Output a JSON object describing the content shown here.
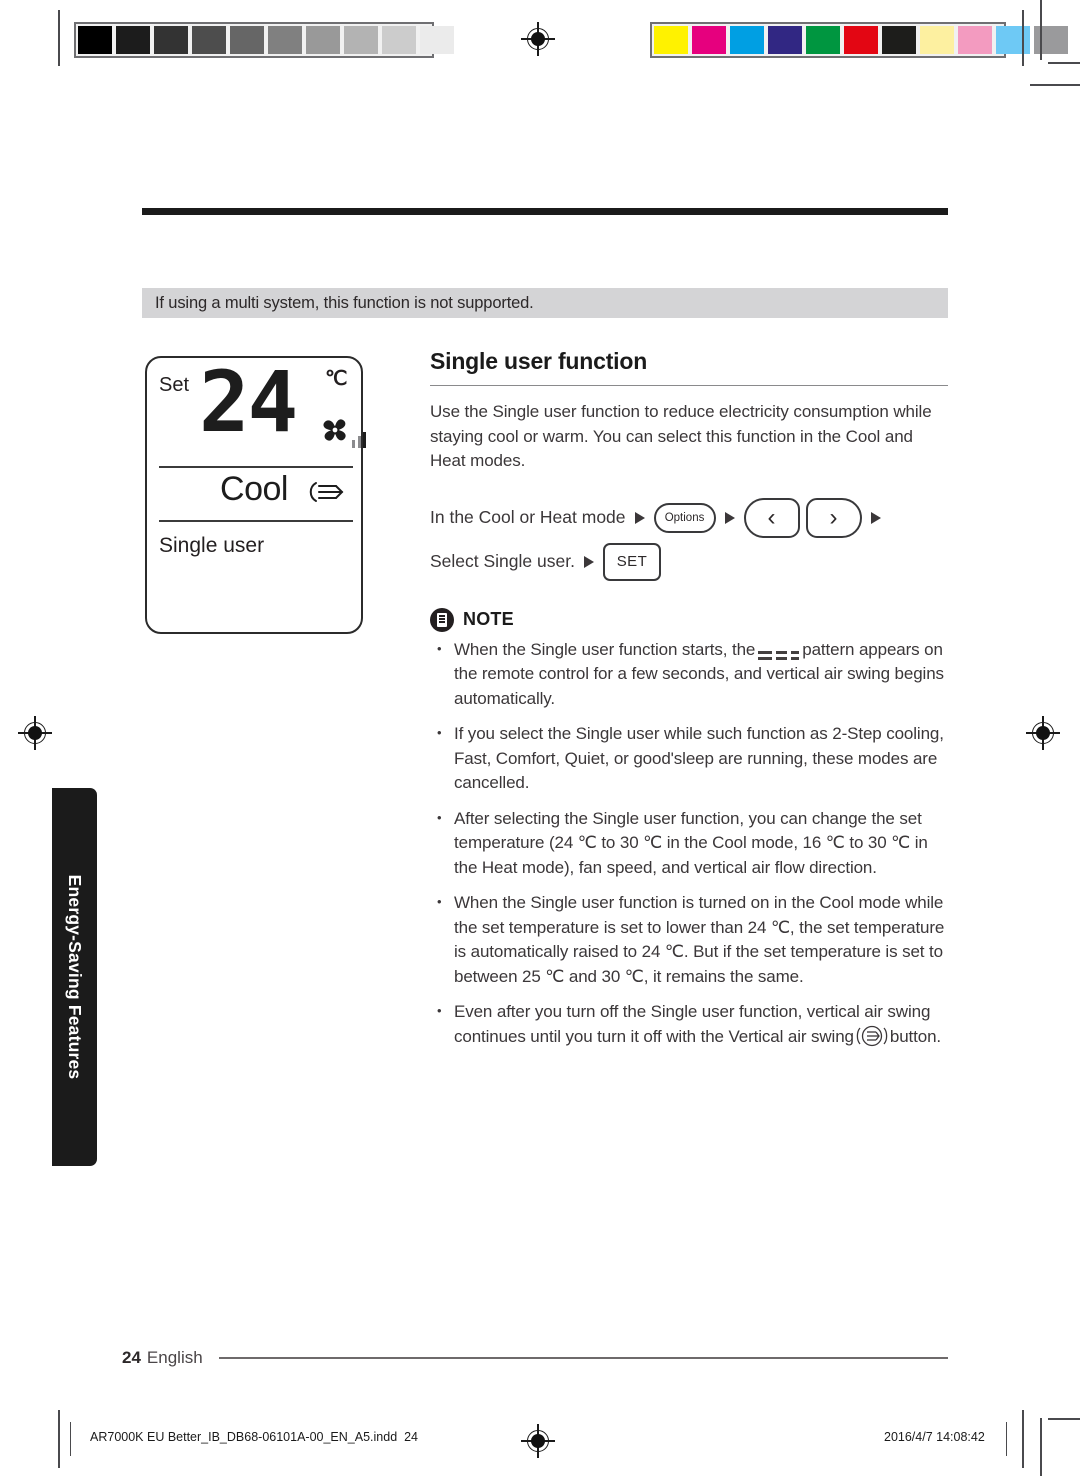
{
  "print_marks": {
    "grayscale_swatches": [
      "#000000",
      "#1c1c1c",
      "#333333",
      "#4d4d4d",
      "#666666",
      "#808080",
      "#999999",
      "#b3b3b3",
      "#cccccc",
      "#ebebeb",
      "#ffffff"
    ],
    "color_swatches": [
      "#fff200",
      "#e6007e",
      "#009fe3",
      "#312783",
      "#009640",
      "#e30613",
      "#1d1d1b",
      "#fdf0a0",
      "#f39bc0",
      "#6ec9f5",
      "#9a9a9c"
    ],
    "registration_icon": "registration-target-icon"
  },
  "banner": {
    "text": "If using a multi system, this function is not supported."
  },
  "lcd": {
    "set_label": "Set",
    "temperature": "24",
    "degree_unit": "℃",
    "fan_icon": "fan-icon",
    "fan_speed_bars": 3,
    "mode": "Cool",
    "swing_icon": "vertical-air-swing-icon",
    "status": "Single user"
  },
  "section": {
    "title": "Single user function",
    "intro": "Use the Single user function to reduce electricity consumption while staying cool or warm. You can select this function in the Cool and Heat modes."
  },
  "steps": [
    {
      "label": "In the Cool or Heat mode",
      "buttons": [
        {
          "type": "options",
          "label": "Options",
          "name": "options-button"
        },
        {
          "type": "arrow-left",
          "label": "‹",
          "name": "left-arrow-button"
        },
        {
          "type": "arrow-right",
          "label": "›",
          "name": "right-arrow-button"
        }
      ],
      "trailing_arrow": true
    },
    {
      "label": "Select Single user.",
      "buttons": [
        {
          "type": "set",
          "label": "SET",
          "name": "set-button"
        }
      ],
      "trailing_arrow": false
    }
  ],
  "note": {
    "icon": "note-document-icon",
    "label": "NOTE",
    "bullets": [
      {
        "pre": "When the Single user function starts, the",
        "inline_icon": "dash-pattern-icon",
        "post": "pattern appears on the remote control for a few seconds, and vertical air swing begins automatically."
      },
      {
        "text": "If you select the Single user while such function as 2-Step cooling, Fast, Comfort, Quiet, or good'sleep are running, these modes are cancelled."
      },
      {
        "text": "After selecting the Single user function, you can change the set temperature (24 ℃ to 30 ℃ in the Cool mode, 16 ℃ to 30 ℃ in the Heat mode), fan speed, and vertical air flow direction."
      },
      {
        "text": "When the Single user function is turned on in the Cool mode while the set temperature is set to lower than 24 ℃, the set temperature is automatically raised to 24 ℃. But if the set temperature is set to between 25 ℃ and 30 ℃, it remains the same."
      },
      {
        "pre": "Even after you turn off the Single user function, vertical air swing continues until you turn it off with the Vertical air swing",
        "inline_icon": "vertical-air-swing-button-icon",
        "post": "button."
      }
    ]
  },
  "side_tab": {
    "label": "Energy-Saving Features"
  },
  "footer": {
    "page_number": "24",
    "language": "English"
  },
  "print_footer": {
    "file_name": "AR7000K EU Better_IB_DB68-06101A-00_EN_A5.indd",
    "file_page": "24",
    "timestamp": "2016/4/7   14:08:42"
  }
}
